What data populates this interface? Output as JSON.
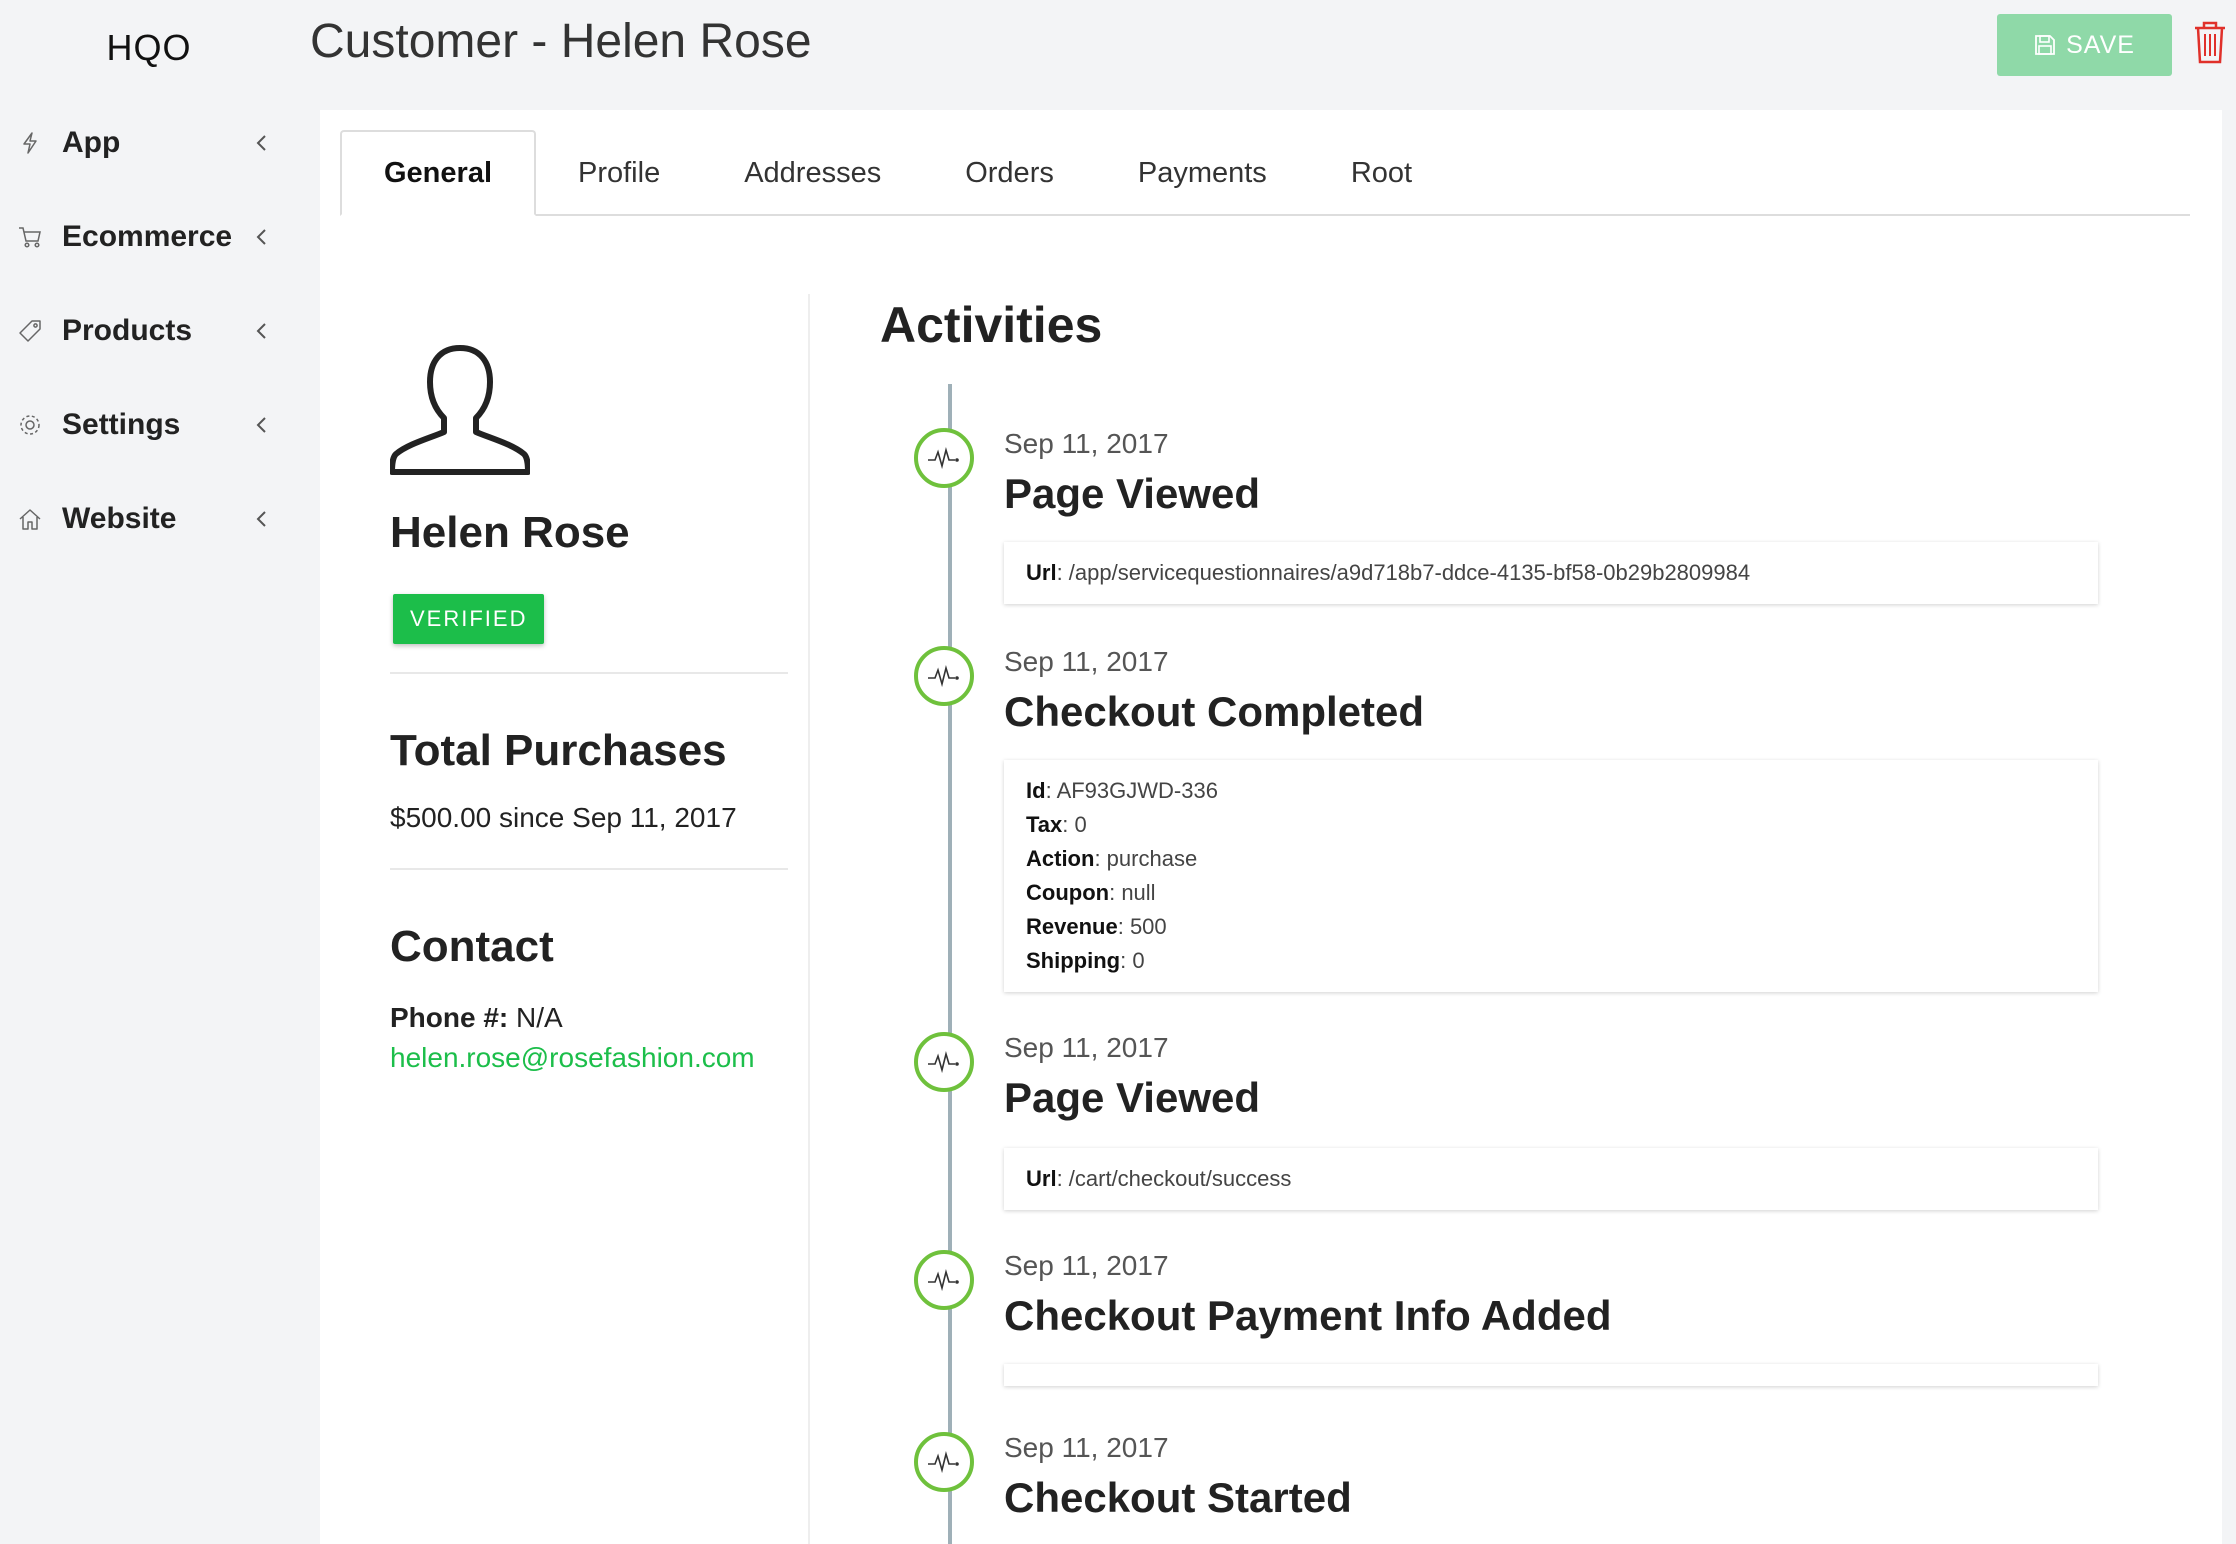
{
  "brand": "HQO",
  "sidebar": {
    "items": [
      {
        "label": "App",
        "icon": "bolt-icon"
      },
      {
        "label": "Ecommerce",
        "icon": "cart-icon"
      },
      {
        "label": "Products",
        "icon": "tag-icon"
      },
      {
        "label": "Settings",
        "icon": "gear-icon"
      },
      {
        "label": "Website",
        "icon": "home-icon"
      }
    ]
  },
  "header": {
    "title": "Customer - Helen Rose",
    "save_label": "SAVE"
  },
  "tabs": [
    {
      "label": "General",
      "active": true
    },
    {
      "label": "Profile"
    },
    {
      "label": "Addresses"
    },
    {
      "label": "Orders"
    },
    {
      "label": "Payments"
    },
    {
      "label": "Root"
    }
  ],
  "customer": {
    "name": "Helen Rose",
    "status": "VERIFIED"
  },
  "purchases": {
    "title": "Total Purchases",
    "line": "$500.00  since Sep 11, 2017"
  },
  "contact": {
    "title": "Contact",
    "phone_label": "Phone #:",
    "phone_value": " N/A",
    "email": "helen.rose@rosefashion.com"
  },
  "activities": {
    "title": "Activities",
    "items": [
      {
        "date": "Sep 11, 2017",
        "title": "Page Viewed",
        "fields": [
          {
            "key": "Url",
            "value": ": /app/servicequestionnaires/a9d718b7-ddce-4135-bf58-0b29b2809984"
          }
        ]
      },
      {
        "date": "Sep 11, 2017",
        "title": "Checkout Completed",
        "fields": [
          {
            "key": "Id",
            "value": ": AF93GJWD-336"
          },
          {
            "key": "Tax",
            "value": ": 0"
          },
          {
            "key": "Action",
            "value": ": purchase"
          },
          {
            "key": "Coupon",
            "value": ": null"
          },
          {
            "key": "Revenue",
            "value": ": 500"
          },
          {
            "key": "Shipping",
            "value": ": 0"
          }
        ]
      },
      {
        "date": "Sep 11, 2017",
        "title": "Page Viewed",
        "fields": [
          {
            "key": "Url",
            "value": ": /cart/checkout/success"
          }
        ]
      },
      {
        "date": "Sep 11, 2017",
        "title": "Checkout Payment Info Added",
        "fields": []
      },
      {
        "date": "Sep 11, 2017",
        "title": "Checkout Started",
        "fields": []
      }
    ]
  },
  "colors": {
    "accent": "#1cbe4a",
    "save_button": "#8fd9a8",
    "timeline_dot": "#6fc13c",
    "trash": "#e0302a"
  }
}
